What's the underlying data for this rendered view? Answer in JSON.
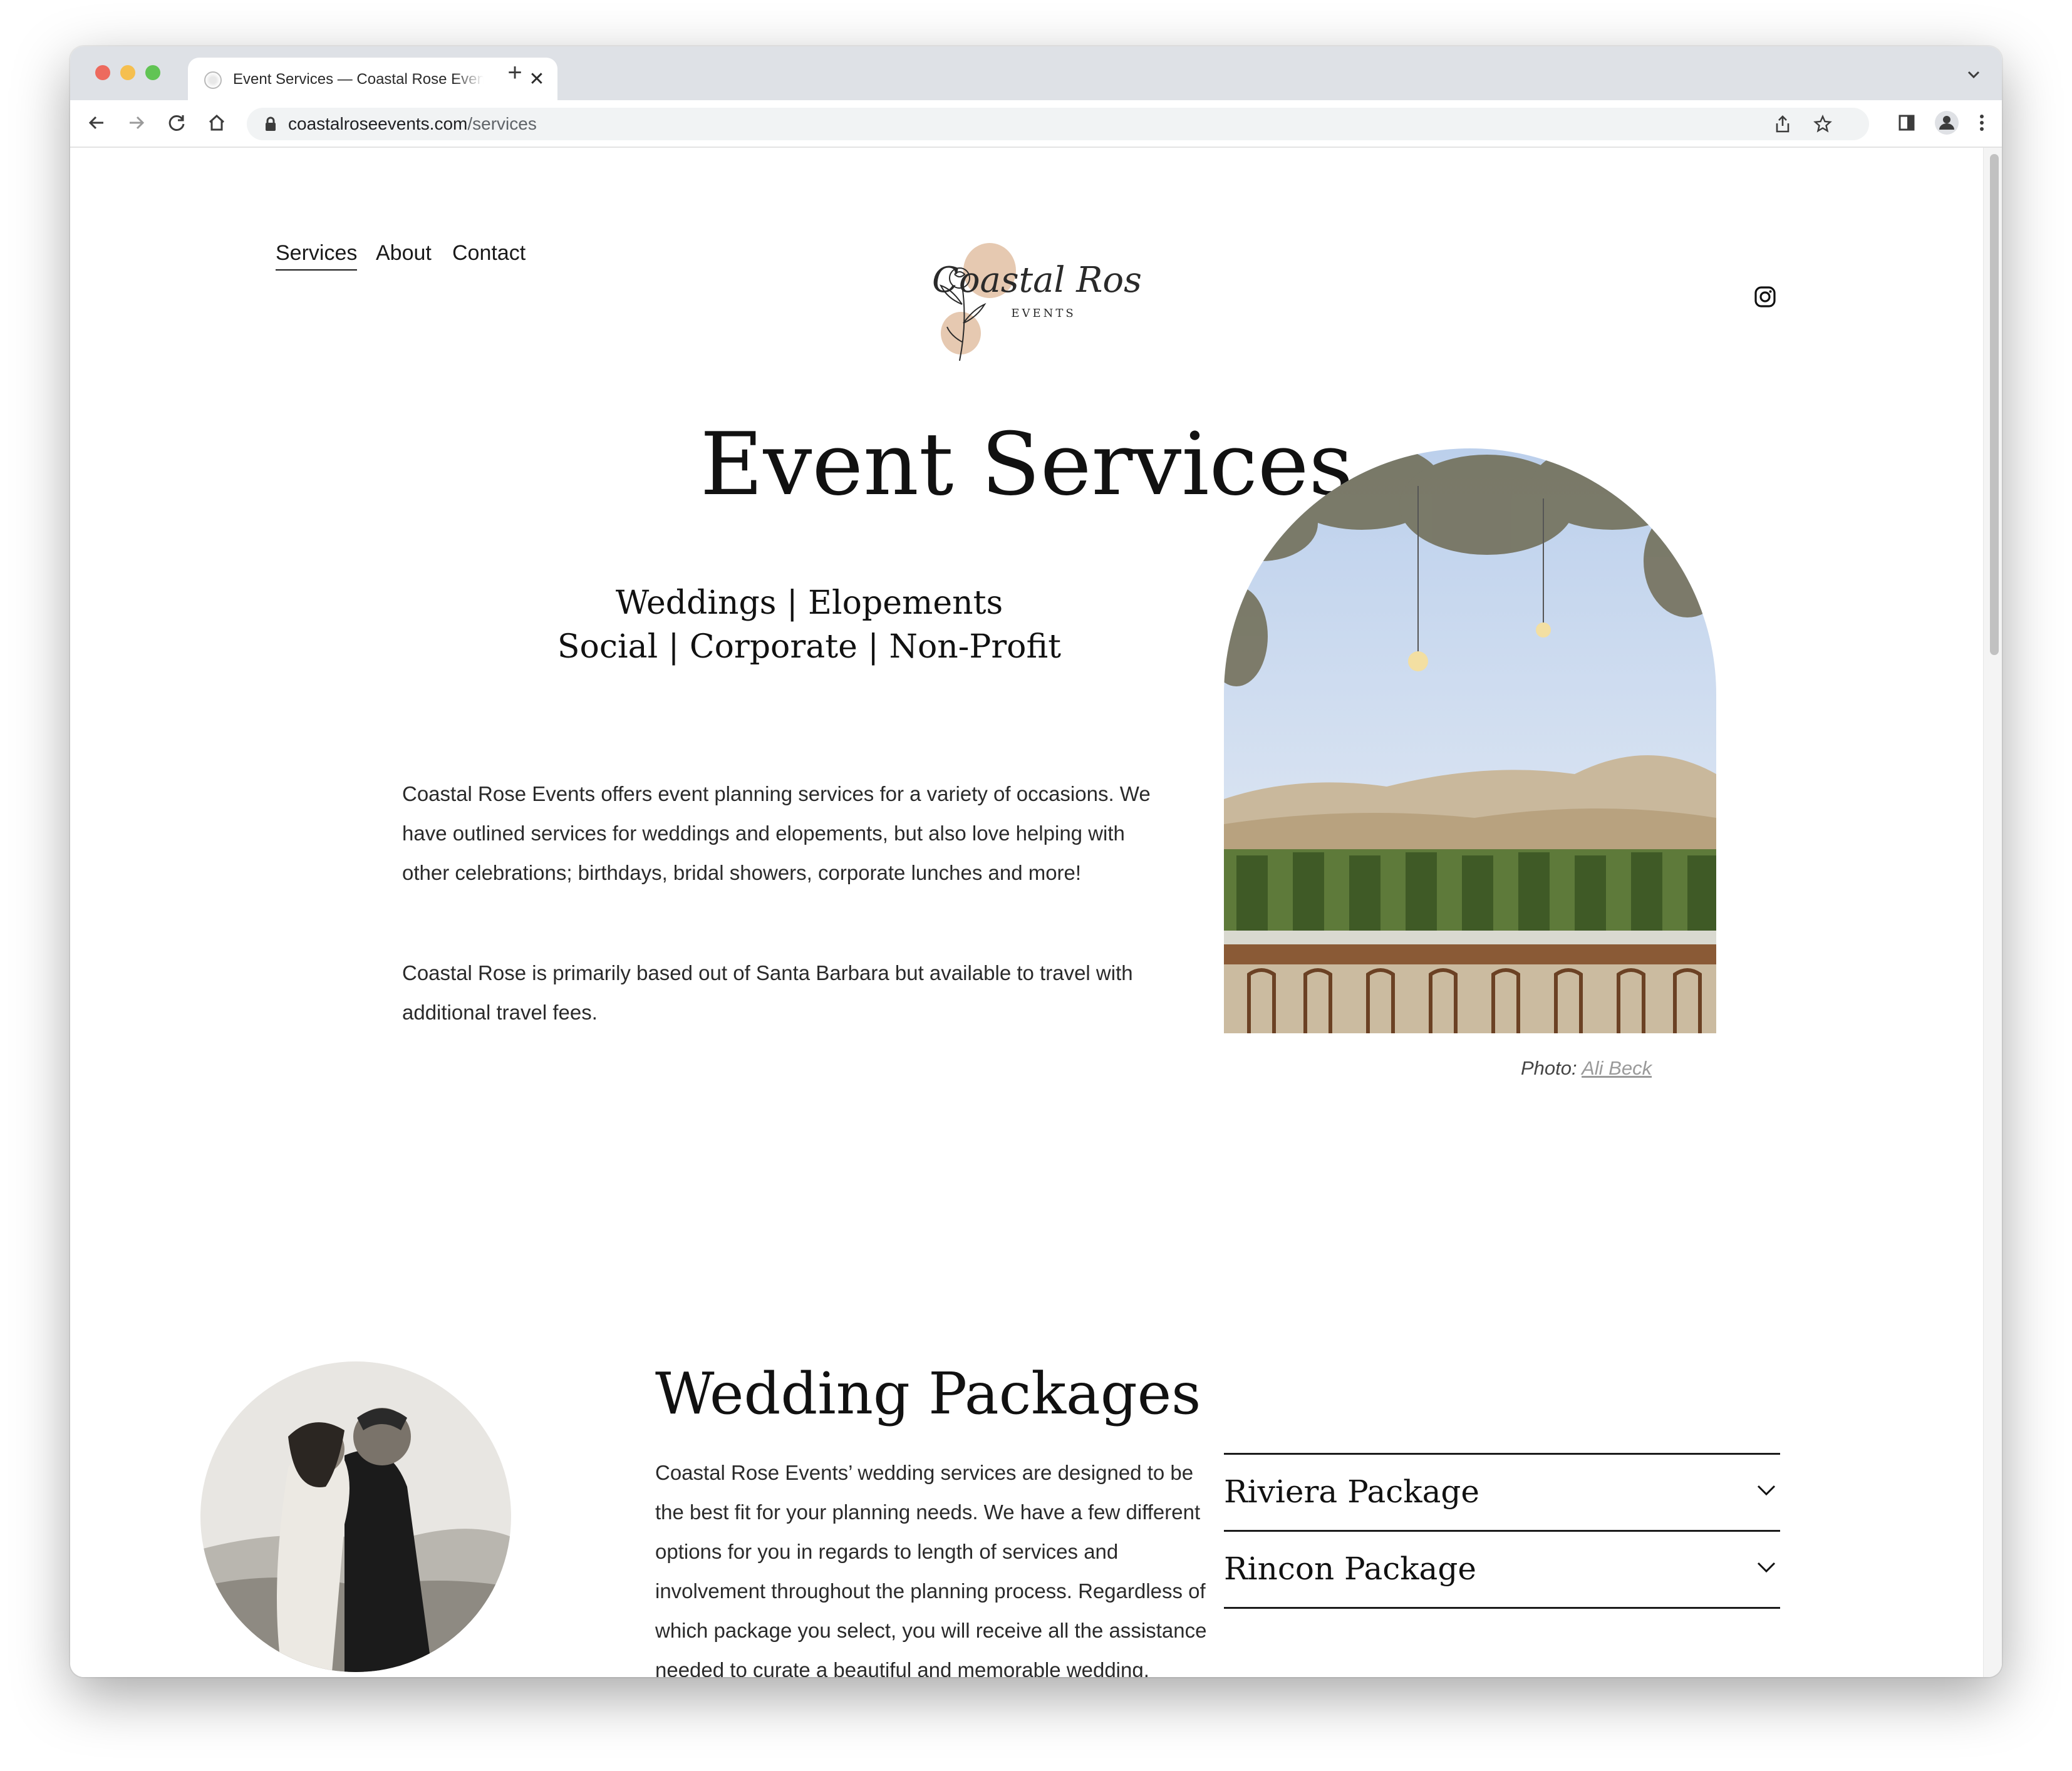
{
  "browser": {
    "tab_title": "Event Services — Coastal Rose Events",
    "tab_close": "✕",
    "new_tab": "+",
    "url_domain": "coastalroseevents.com",
    "url_path": "/services"
  },
  "nav": {
    "items": [
      {
        "label": "Services",
        "active": true
      },
      {
        "label": "About"
      },
      {
        "label": "Contact"
      }
    ]
  },
  "logo": {
    "text_main": "Coastal Rose",
    "text_sub": "EVENTS",
    "accent_color": "#e6c9b1"
  },
  "hero": {
    "title": "Event Services",
    "tagline_line1": "Weddings | Elopements",
    "tagline_line2": "Social | Corporate | Non-Profit",
    "intro_p1": "Coastal Rose Events offers event planning services for a variety of occasions. We have outlined services for weddings and elopements, but also love helping with other celebrations; birthdays, bridal showers, corporate lunches and more!",
    "intro_p2": "Coastal Rose is primarily based out of Santa Barbara but available to travel with additional travel fees.",
    "photo_credit_label": "Photo:",
    "photo_credit_name": "Ali Beck"
  },
  "wedding": {
    "heading": "Wedding Packages",
    "description": "Coastal Rose Events’ wedding services are designed to be the best fit for your planning needs. We have a few different options for you in regards to length of services and involvement throughout the planning process. Regardless of which package you select, you will receive all the assistance needed to curate a beautiful and memorable wedding.",
    "packages": [
      {
        "name": "Riviera Package"
      },
      {
        "name": "Rincon Package"
      }
    ]
  },
  "icons": {
    "back": "back-arrow-icon",
    "forward": "forward-arrow-icon",
    "reload": "reload-icon",
    "home": "home-icon",
    "share": "share-icon",
    "bookmark": "star-icon",
    "sidepanel": "side-panel-icon",
    "profile": "profile-icon",
    "menu": "kebab-menu-icon",
    "social": "instagram-icon"
  }
}
